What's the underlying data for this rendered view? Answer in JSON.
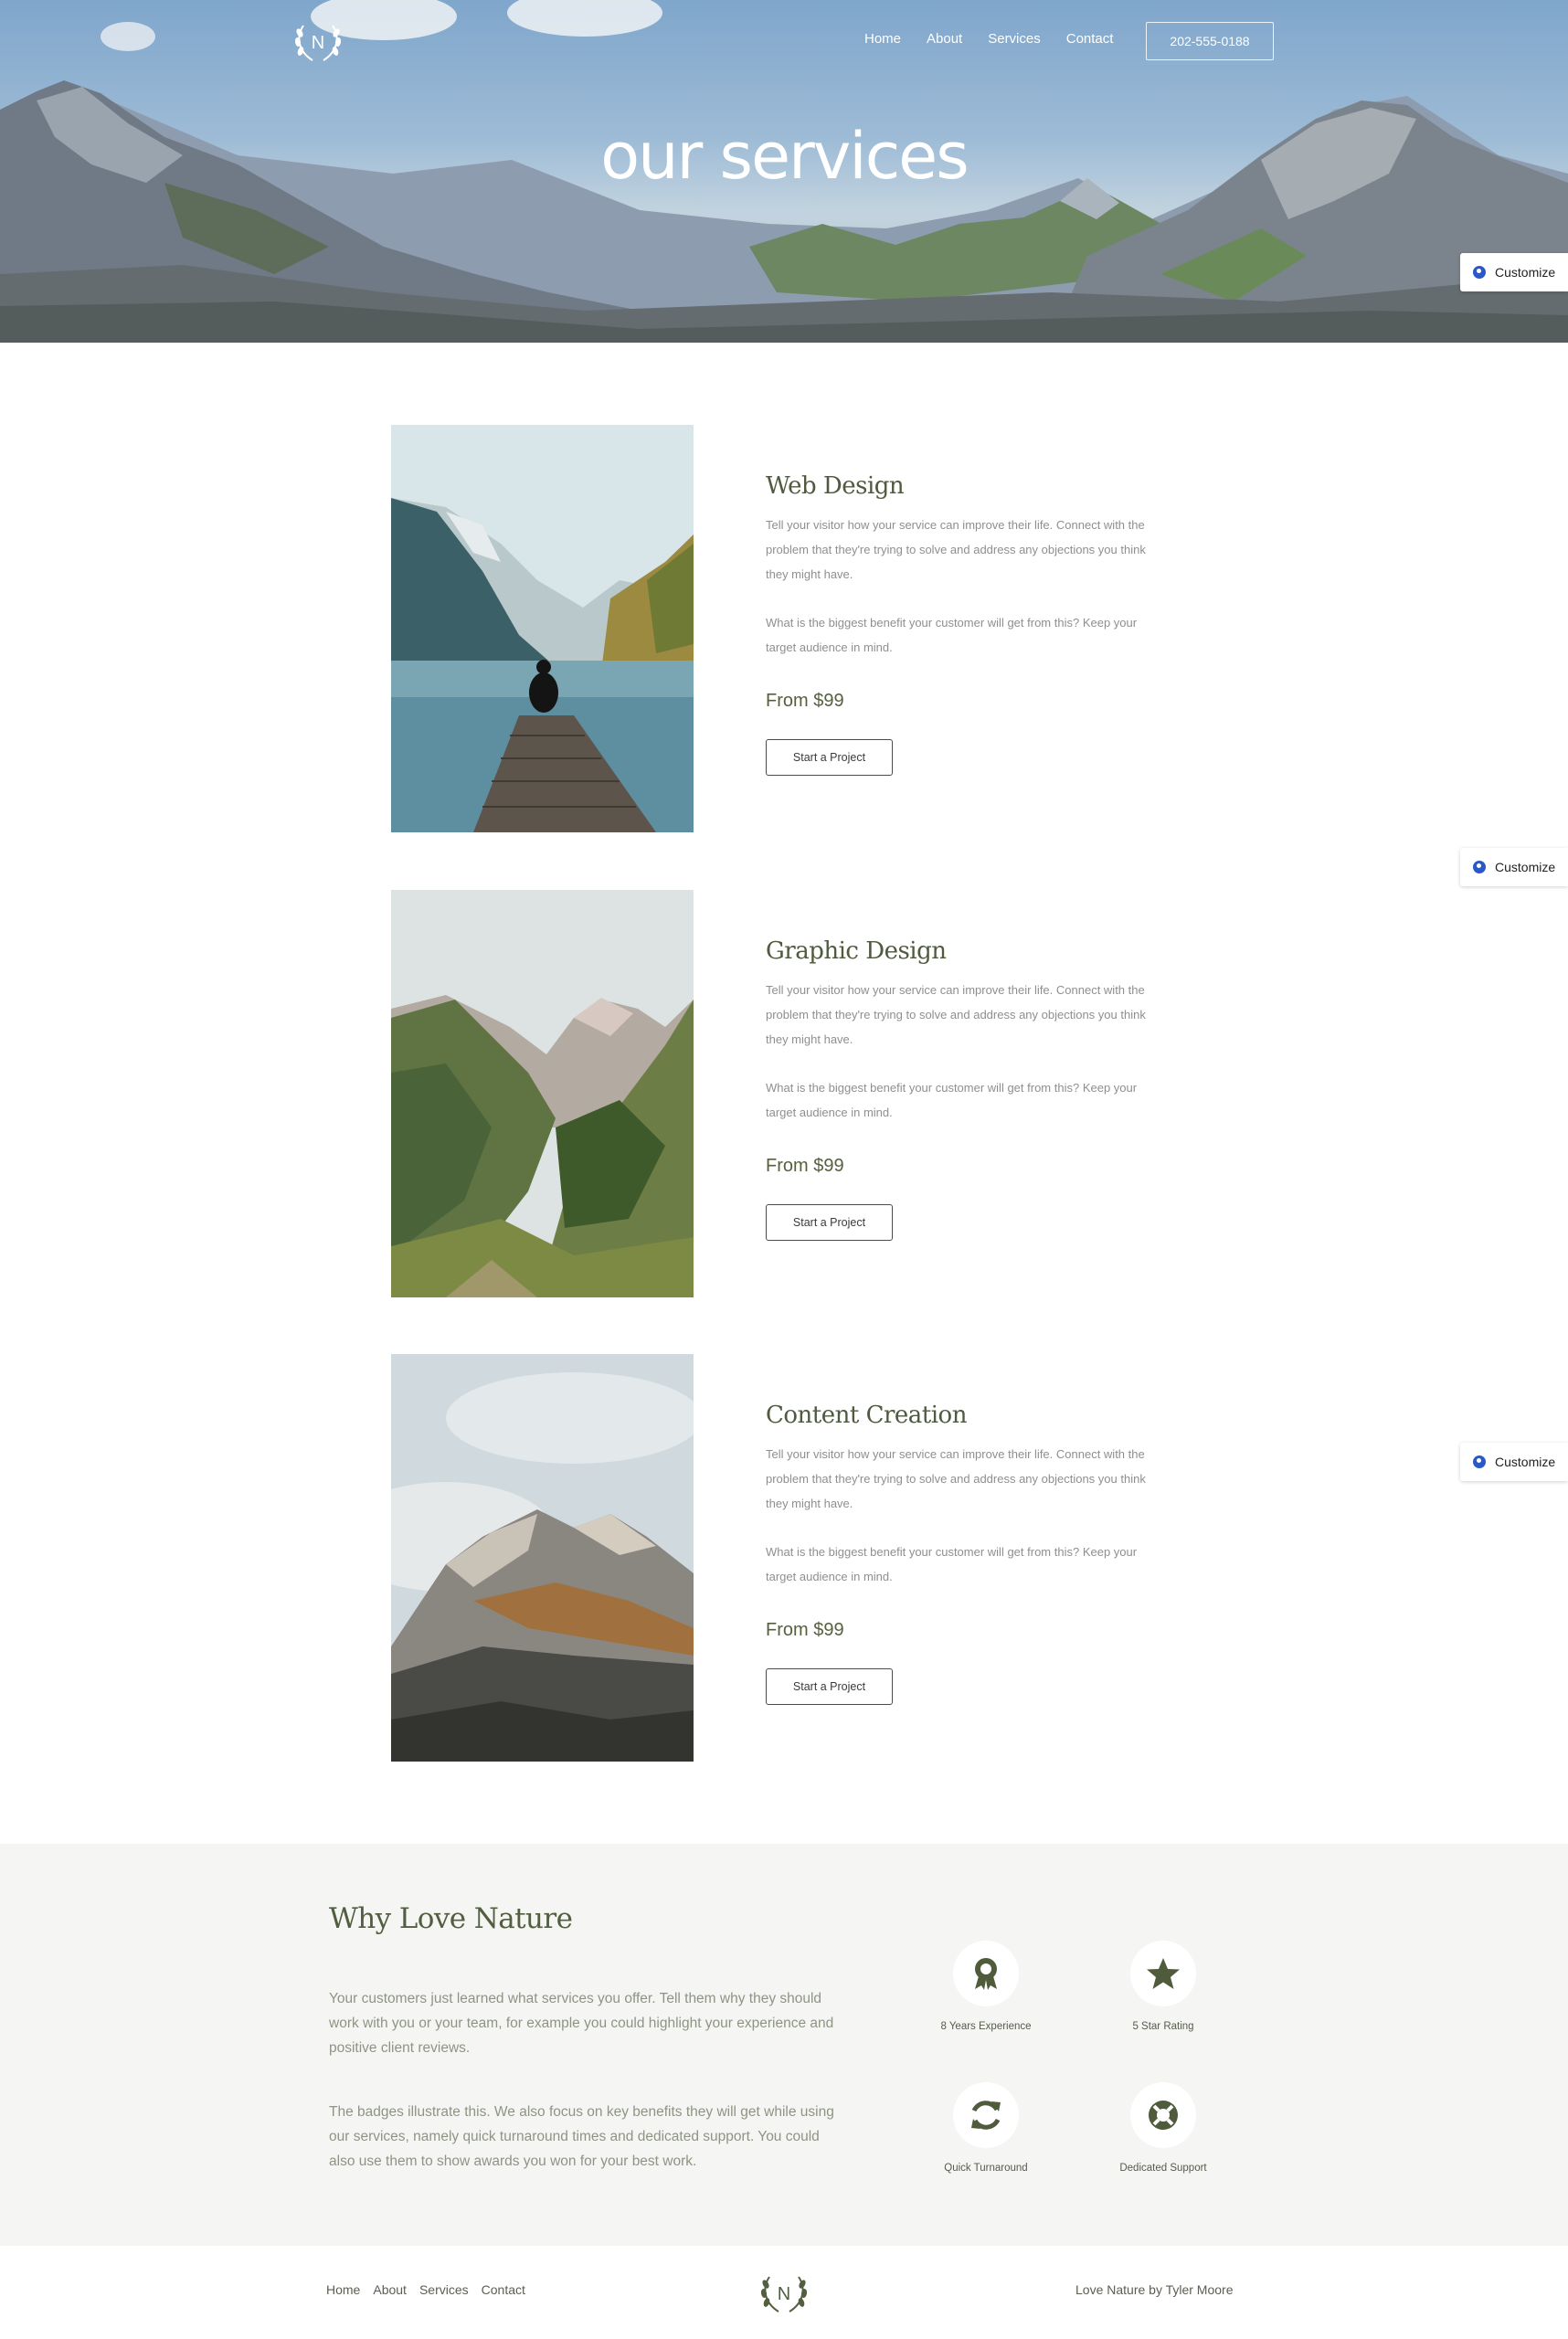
{
  "header": {
    "logo_letter": "N",
    "nav": [
      "Home",
      "About",
      "Services",
      "Contact"
    ],
    "phone": "202-555-0188"
  },
  "hero": {
    "title": "our services"
  },
  "customize_label": "Customize",
  "services": [
    {
      "title": "Web Design",
      "p1": "Tell your visitor how your service can improve their life. Connect with the problem that they're trying to solve and address any objections you think they might have.",
      "p2": "What is the biggest benefit your customer will get from this? Keep your target audience in mind.",
      "price": "From $99",
      "cta": "Start a Project"
    },
    {
      "title": "Graphic Design",
      "p1": "Tell your visitor how your service can improve their life. Connect with the problem that they're trying to solve and address any objections you think they might have.",
      "p2": "What is the biggest benefit your customer will get from this? Keep your target audience in mind.",
      "price": "From $99",
      "cta": "Start a Project"
    },
    {
      "title": "Content Creation",
      "p1": "Tell your visitor how your service can improve their life. Connect with the problem that they're trying to solve and address any objections you think they might have.",
      "p2": "What is the biggest benefit your customer will get from this? Keep your target audience in mind.",
      "price": "From $99",
      "cta": "Start a Project"
    }
  ],
  "why": {
    "title": "Why Love Nature",
    "p1": "Your customers just learned what services you offer. Tell them why they should work with you or your team, for example you could highlight your experience and positive client reviews.",
    "p2": "The badges illustrate this.  We also focus on key benefits they will get while using our services, namely quick turnaround times and dedicated support. You could also use them to show awards you won for your best work.",
    "badges": [
      {
        "label": "8 Years Experience",
        "icon": "award-icon"
      },
      {
        "label": "5 Star Rating",
        "icon": "star-icon"
      },
      {
        "label": "Quick Turnaround",
        "icon": "refresh-icon"
      },
      {
        "label": "Dedicated Support",
        "icon": "lifebuoy-icon"
      }
    ]
  },
  "footer": {
    "nav": [
      "Home",
      "About",
      "Services",
      "Contact"
    ],
    "logo_letter": "N",
    "credit": "Love Nature by Tyler Moore"
  },
  "colors": {
    "olive": "#525e40",
    "why_bg": "#f5f6f3",
    "customize_icon": "#2a58c8"
  }
}
